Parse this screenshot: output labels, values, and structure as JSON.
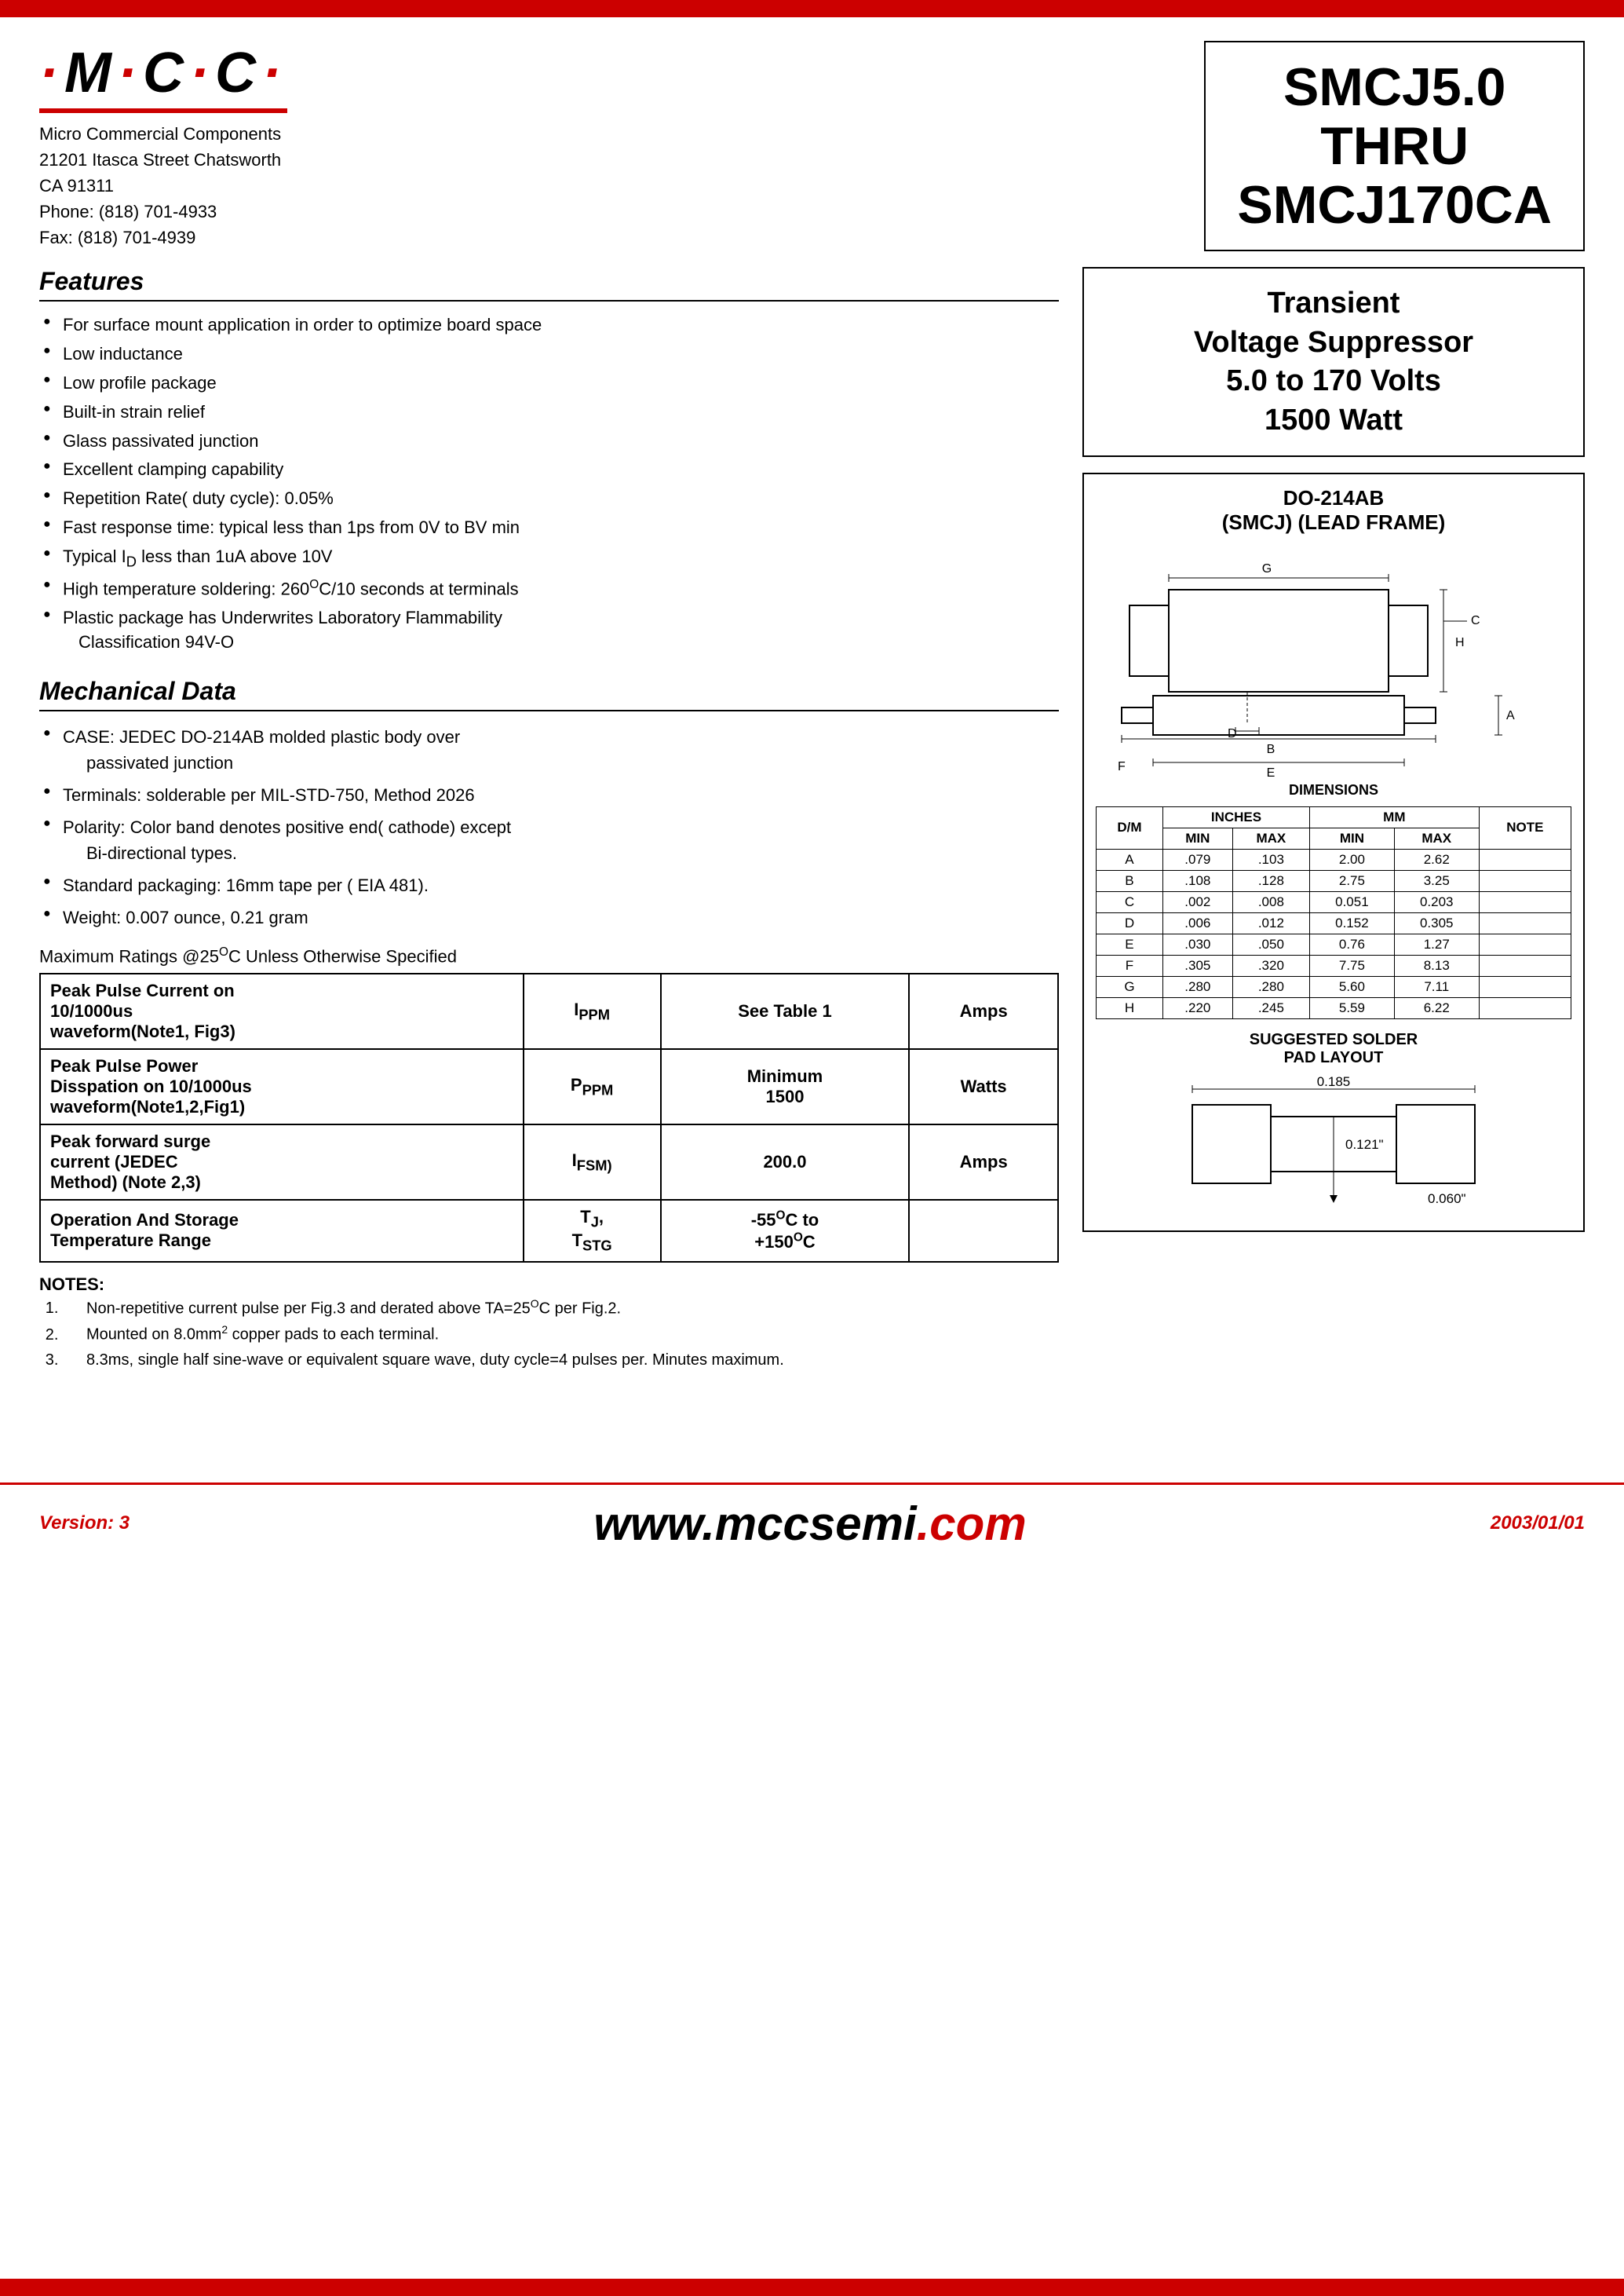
{
  "top_bar": {
    "color": "#cc0000"
  },
  "logo": {
    "text": "·M·C·C·",
    "company_name": "Micro Commercial Components",
    "address_line1": "21201 Itasca Street Chatsworth",
    "address_line2": "CA 91311",
    "phone": "Phone:  (818) 701-4933",
    "fax": "Fax:    (818) 701-4939"
  },
  "part_number": {
    "line1": "SMCJ5.0",
    "line2": "THRU",
    "line3": "SMCJ170CA"
  },
  "description": {
    "line1": "Transient",
    "line2": "Voltage Suppressor",
    "line3": "5.0 to 170 Volts",
    "line4": "1500 Watt"
  },
  "package": {
    "title_line1": "DO-214AB",
    "title_line2": "(SMCJ) (LEAD FRAME)"
  },
  "features": {
    "title": "Features",
    "items": [
      "For surface mount application in order to optimize board space",
      "Low inductance",
      "Low profile package",
      "Built-in strain relief",
      "Glass passivated junction",
      "Excellent clamping capability",
      "Repetition Rate( duty cycle): 0.05%",
      "Fast response time: typical less than 1ps from 0V to BV min",
      "Typical I₀ less than 1uA above 10V",
      "High temperature soldering: 260°C/10 seconds at terminals",
      "Plastic package has Underwrites Laboratory Flammability Classification 94V-O"
    ]
  },
  "mechanical": {
    "title": "Mechanical Data",
    "items": [
      {
        "text": "CASE: JEDEC DO-214AB molded plastic body over",
        "indent": "passivated junction"
      },
      {
        "text": "Terminals:  solderable per MIL-STD-750, Method 2026"
      },
      {
        "text": "Polarity: Color band denotes positive end( cathode) except",
        "indent": "Bi-directional types."
      },
      {
        "text": "Standard packaging: 16mm tape per ( EIA 481)."
      },
      {
        "text": "Weight: 0.007 ounce, 0.21 gram"
      }
    ]
  },
  "max_ratings_title": "Maximum Ratings @25°C Unless Otherwise Specified",
  "ratings_table": [
    {
      "label": "Peak Pulse Current on 10/1000us waveform(Note1, Fig3)",
      "symbol": "IPPM",
      "value": "See Table 1",
      "unit": "Amps"
    },
    {
      "label": "Peak Pulse Power Disspation on 10/1000us waveform(Note1,2,Fig1)",
      "symbol": "PPPM",
      "value": "Minimum 1500",
      "unit": "Watts"
    },
    {
      "label": "Peak forward surge current (JEDEC Method) (Note 2,3)",
      "symbol": "IFSM)",
      "value": "200.0",
      "unit": "Amps"
    },
    {
      "label": "Operation And Storage Temperature Range",
      "symbol": "TJ, TSTG",
      "value": "-55°C to +150°C",
      "unit": ""
    }
  ],
  "notes": {
    "title": "NOTES:",
    "items": [
      "Non-repetitive current pulse per Fig.3 and derated above TA=25°C per Fig.2.",
      "Mounted on 8.0mm² copper pads to each terminal.",
      "8.3ms, single half sine-wave or equivalent square wave, duty cycle=4 pulses per. Minutes maximum."
    ]
  },
  "dimensions_table": {
    "header": [
      "D/M",
      "MIN",
      "MAX",
      "MIN",
      "MAX",
      "NOTE"
    ],
    "sub_header": [
      "",
      "INCHES",
      "",
      "MM",
      "",
      ""
    ],
    "rows": [
      [
        "A",
        ".079",
        ".103",
        "2.00",
        "2.62",
        ""
      ],
      [
        "B",
        ".108",
        ".128",
        "2.75",
        "3.25",
        ""
      ],
      [
        "C",
        ".002",
        ".008",
        "0.051",
        "0.203",
        ""
      ],
      [
        "D",
        ".006",
        ".012",
        "0.152",
        "0.305",
        ""
      ],
      [
        "E",
        ".030",
        ".050",
        "0.76",
        "1.27",
        ""
      ],
      [
        "F",
        ".305",
        ".320",
        "7.75",
        "8.13",
        ""
      ],
      [
        "G",
        ".280",
        ".280",
        "5.60",
        "7.11",
        ""
      ],
      [
        "H",
        ".220",
        ".245",
        "5.59",
        "6.22",
        ""
      ]
    ]
  },
  "solder": {
    "title_line1": "SUGGESTED SOLDER",
    "title_line2": "PAD LAYOUT",
    "dim1": "0.185",
    "dim2": "0.121\"",
    "dim3": "0.060\""
  },
  "footer": {
    "version": "Version: 3",
    "website_prefix": "www.mccsemi",
    "website_suffix": ".com",
    "date": "2003/01/01"
  }
}
